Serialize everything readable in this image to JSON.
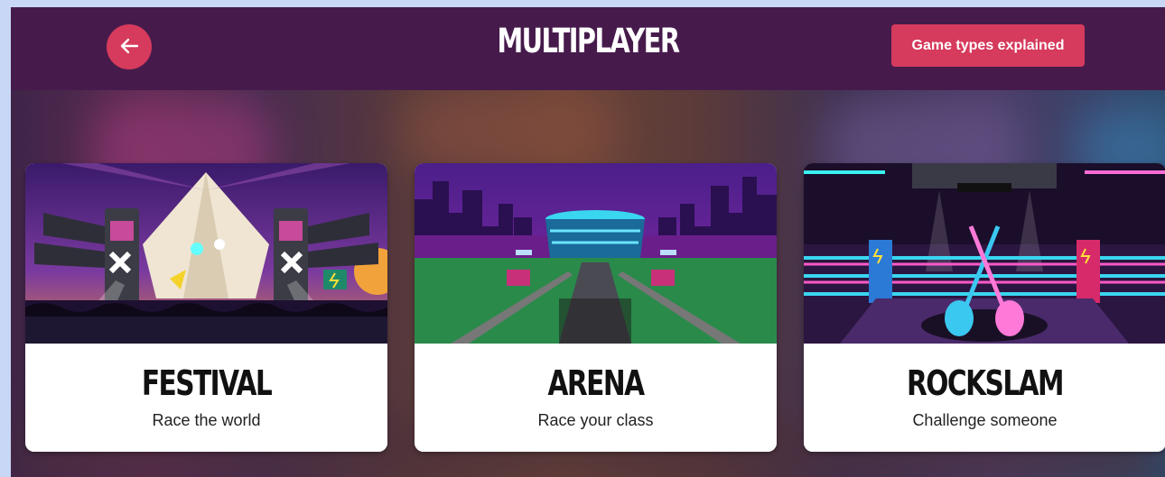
{
  "header": {
    "title": "MULTIPLAYER",
    "back_icon": "arrow-left-icon",
    "explain_label": "Game types explained"
  },
  "colors": {
    "header_bg": "#461b4c",
    "accent": "#d63a5c",
    "card_bg": "#ffffff"
  },
  "cards": [
    {
      "title": "FESTIVAL",
      "subtitle": "Race the world",
      "art": "festival-stage-illustration"
    },
    {
      "title": "ARENA",
      "subtitle": "Race your class",
      "art": "arena-stadium-illustration"
    },
    {
      "title": "ROCKSLAM",
      "subtitle": "Challenge someone",
      "art": "rockslam-boxing-ring-illustration"
    }
  ]
}
